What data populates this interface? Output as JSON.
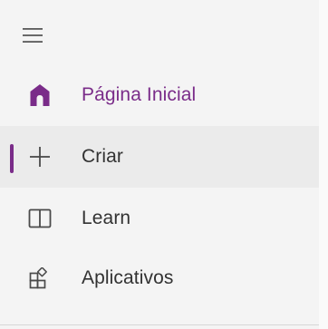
{
  "colors": {
    "accent": "#7a2c89",
    "text_default": "#323232",
    "text_selected": "#7a2c89",
    "icon_default": "#4a4a4a",
    "background": "#f4f4f4",
    "active_background": "#ebebeb"
  },
  "menu": {
    "icon": "hamburger-menu-icon"
  },
  "nav": {
    "items": [
      {
        "label": "Página Inicial",
        "icon": "home-icon",
        "selected": true
      },
      {
        "label": "Criar",
        "icon": "plus-icon",
        "active": true
      },
      {
        "label": "Learn",
        "icon": "book-icon"
      },
      {
        "label": "Aplicativos",
        "icon": "apps-icon"
      }
    ]
  }
}
